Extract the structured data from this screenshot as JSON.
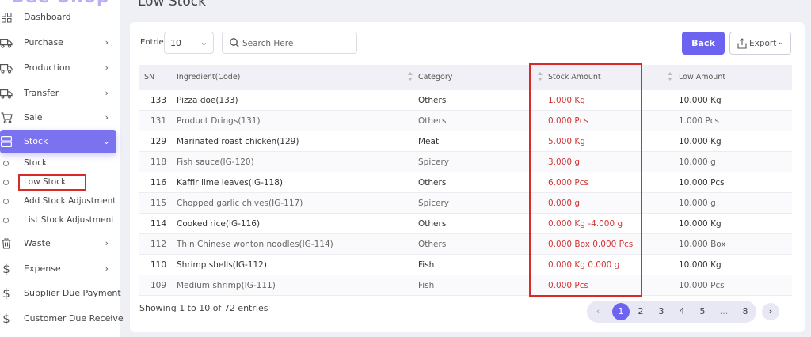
{
  "brand": "Bee Shop",
  "sidebar": {
    "items": [
      {
        "label": "Dashboard",
        "icon": "dashboard-icon",
        "chevron": false
      },
      {
        "label": "Purchase",
        "icon": "truck-icon",
        "chevron": true
      },
      {
        "label": "Production",
        "icon": "truck-icon",
        "chevron": true
      },
      {
        "label": "Transfer",
        "icon": "truck-icon",
        "chevron": true
      },
      {
        "label": "Sale",
        "icon": "cart-icon",
        "chevron": true
      },
      {
        "label": "Stock",
        "icon": "stock-icon",
        "chevron": true,
        "active": true
      },
      {
        "label": "Waste",
        "icon": "trash-icon",
        "chevron": true
      },
      {
        "label": "Expense",
        "icon": "dollar-icon",
        "chevron": true
      },
      {
        "label": "Supplier Due Payment",
        "icon": "dollar-icon",
        "chevron": true
      },
      {
        "label": "Customer Due Receive",
        "icon": "dollar-icon",
        "chevron": true
      }
    ],
    "stock_sub": [
      "Stock",
      "Low Stock",
      "Add Stock Adjustment",
      "List Stock Adjustment"
    ]
  },
  "page_title": "Low Stock",
  "controls": {
    "entries_label": "Entries",
    "entries_value": "10",
    "search_placeholder": "Search Here",
    "back_label": "Back",
    "export_label": "Export"
  },
  "table": {
    "headers": [
      "SN",
      "Ingredient(Code)",
      "Category",
      "Stock Amount",
      "Low Amount"
    ],
    "rows": [
      [
        "133",
        "Pizza doe(133)",
        "Others",
        "1.000 Kg",
        "10.000 Kg"
      ],
      [
        "131",
        "Product Drings(131)",
        "Others",
        "0.000 Pcs",
        "1.000 Pcs"
      ],
      [
        "129",
        "Marinated roast chicken(129)",
        "Meat",
        "5.000 Kg",
        "10.000 Kg"
      ],
      [
        "118",
        "Fish sauce(IG-120)",
        "Spicery",
        "3.000 g",
        "10.000 g"
      ],
      [
        "116",
        "Kaffir lime leaves(IG-118)",
        "Others",
        "6.000 Pcs",
        "10.000 Pcs"
      ],
      [
        "115",
        "Chopped garlic chives(IG-117)",
        "Spicery",
        "0.000 g",
        "10.000 g"
      ],
      [
        "114",
        "Cooked rice(IG-116)",
        "Others",
        "0.000 Kg -4.000 g",
        "10.000 Kg"
      ],
      [
        "112",
        "Thin Chinese wonton noodles(IG-114)",
        "Others",
        "0.000 Box 0.000 Pcs",
        "10.000 Box"
      ],
      [
        "110",
        "Shrimp shells(IG-112)",
        "Fish",
        "0.000 Kg 0.000 g",
        "10.000 Kg"
      ],
      [
        "109",
        "Medium shrimp(IG-111)",
        "Fish",
        "0.000 Pcs",
        "10.000 Pcs"
      ]
    ]
  },
  "footer": {
    "showing": "Showing 1 to 10 of 72 entries",
    "pages": [
      "1",
      "2",
      "3",
      "4",
      "5",
      "...",
      "8"
    ],
    "current_page": "1"
  },
  "colors": {
    "accent": "#6c63f0",
    "highlight": "#d92a2a",
    "alert_text": "#d03434"
  }
}
